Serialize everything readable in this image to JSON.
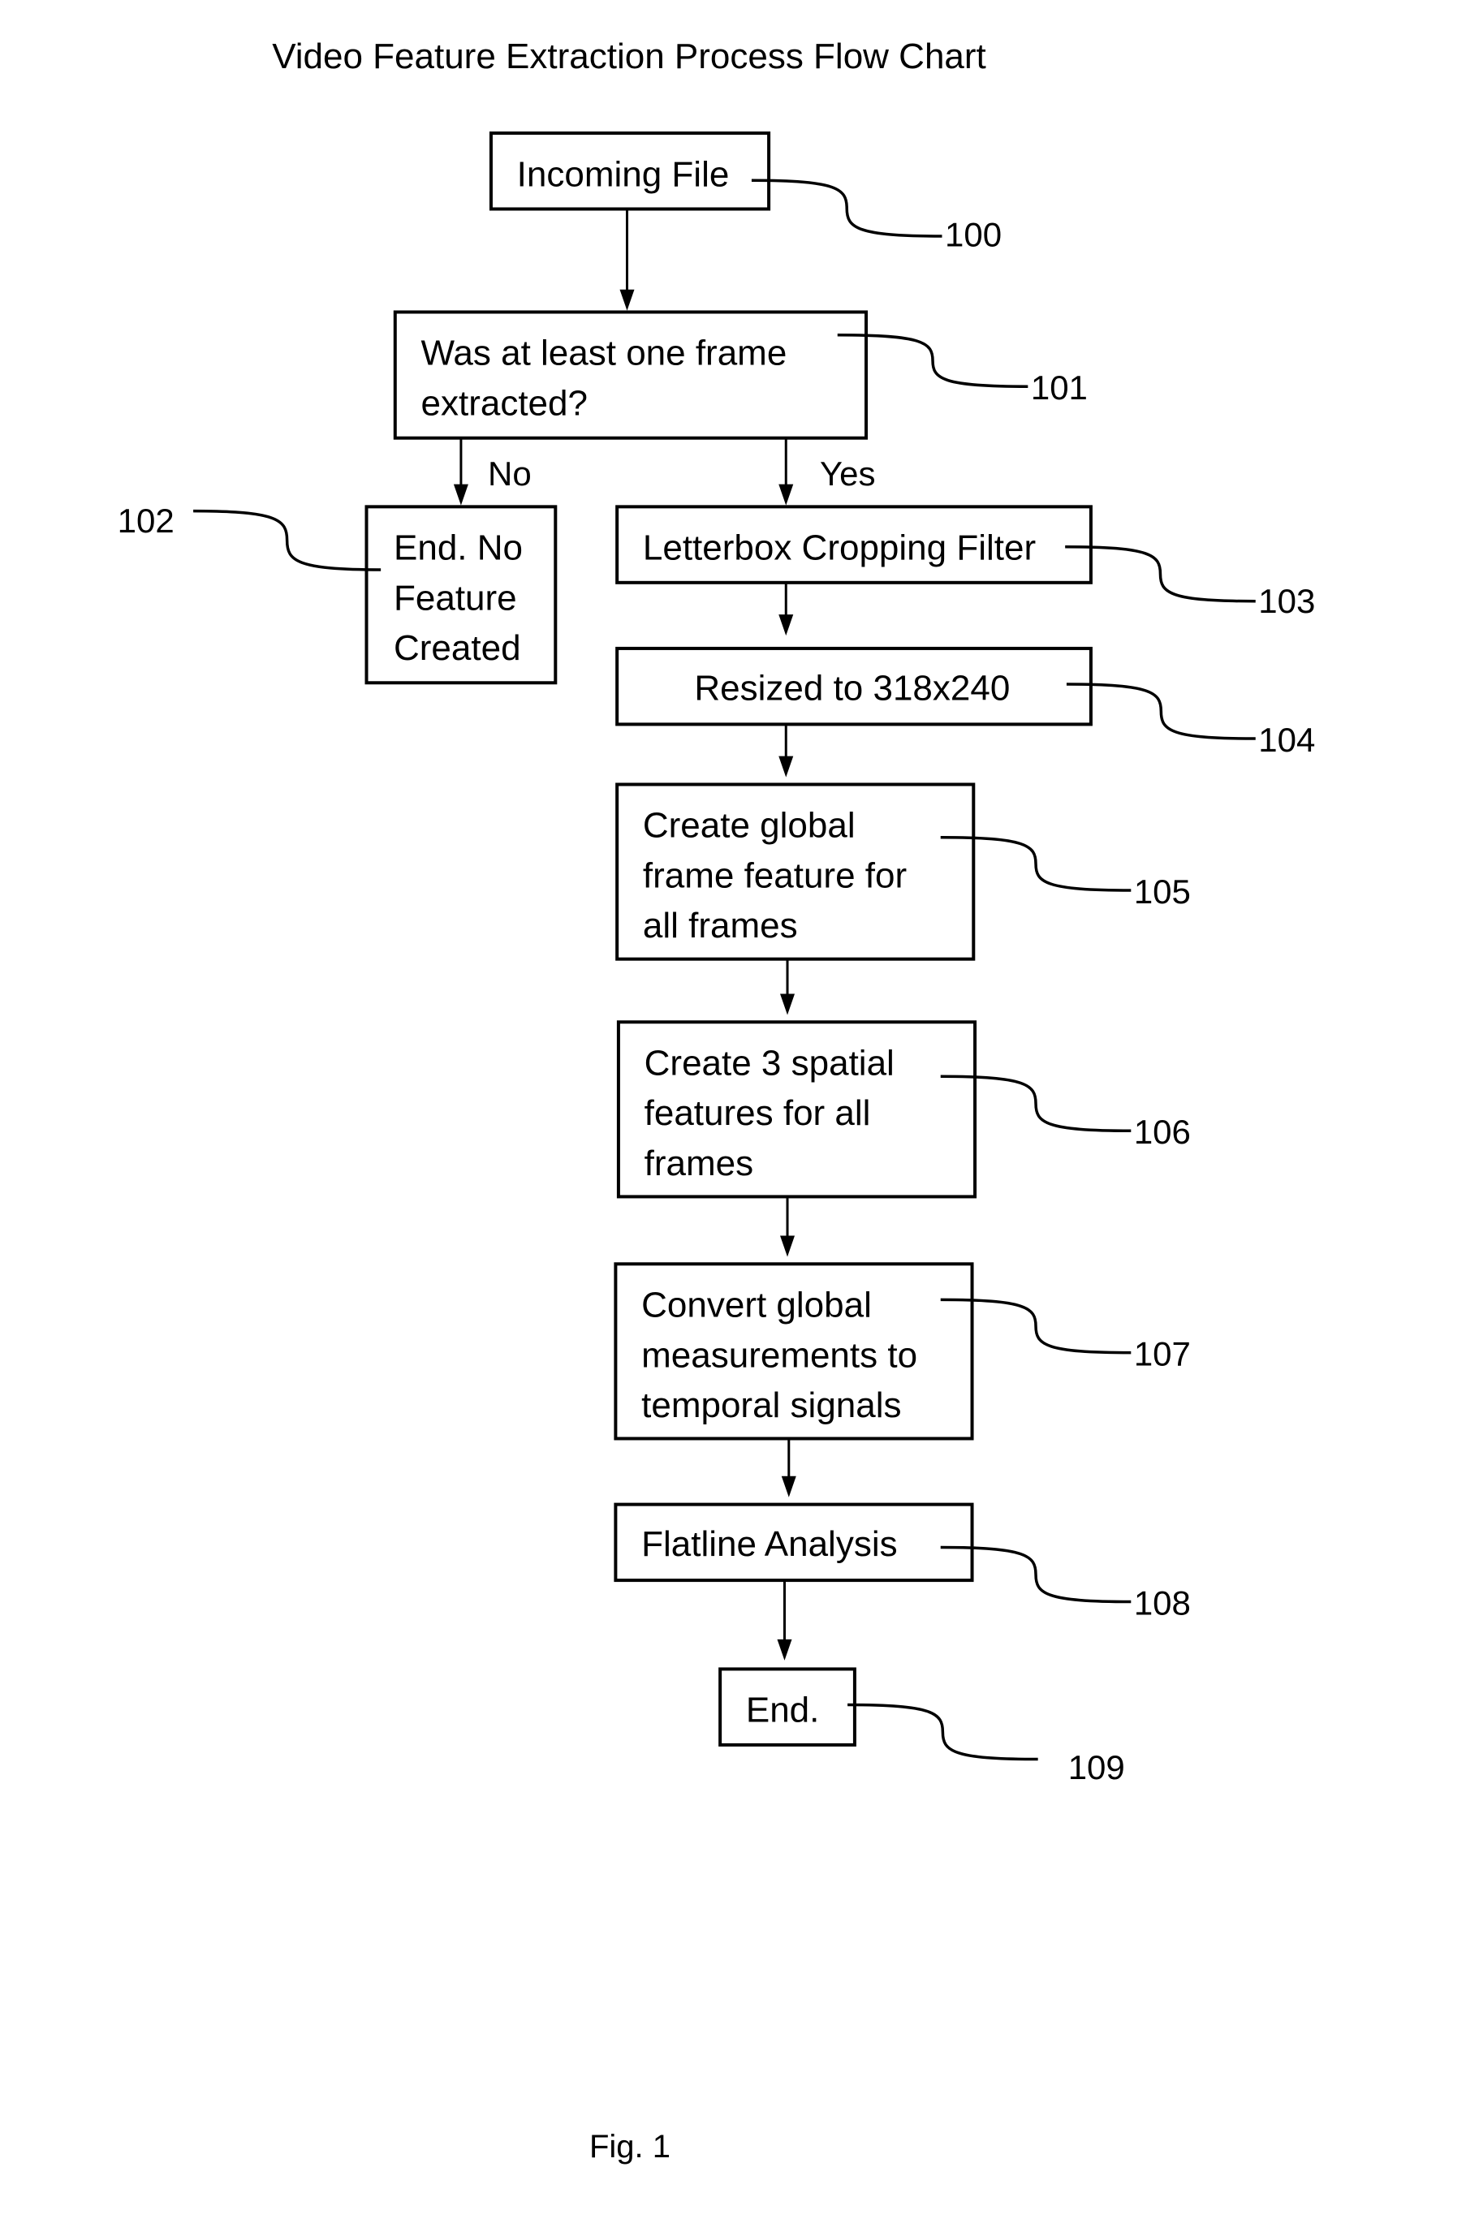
{
  "title": "Video Feature Extraction Process Flow Chart",
  "figure_label": "Fig. 1",
  "nodes": {
    "n100": {
      "ref": "100",
      "lines": [
        "Incoming File"
      ]
    },
    "n101": {
      "ref": "101",
      "lines": [
        "Was at least one frame",
        "extracted?"
      ]
    },
    "n102": {
      "ref": "102",
      "lines": [
        "End. No",
        "Feature",
        "Created"
      ]
    },
    "n103": {
      "ref": "103",
      "lines": [
        "Letterbox Cropping Filter"
      ]
    },
    "n104": {
      "ref": "104",
      "lines": [
        "Resized to 318x240"
      ]
    },
    "n105": {
      "ref": "105",
      "lines": [
        "Create global",
        "frame feature for",
        "all frames"
      ]
    },
    "n106": {
      "ref": "106",
      "lines": [
        "Create 3 spatial",
        "features for all",
        "frames"
      ]
    },
    "n107": {
      "ref": "107",
      "lines": [
        "Convert global",
        "measurements to",
        "temporal signals"
      ]
    },
    "n108": {
      "ref": "108",
      "lines": [
        "Flatline Analysis"
      ]
    },
    "n109": {
      "ref": "109",
      "lines": [
        "End."
      ]
    }
  },
  "branches": {
    "no": "No",
    "yes": "Yes"
  },
  "edges": [
    {
      "from": "n100",
      "to": "n101"
    },
    {
      "from": "n101",
      "to": "n102",
      "label": "No"
    },
    {
      "from": "n101",
      "to": "n103",
      "label": "Yes"
    },
    {
      "from": "n103",
      "to": "n104"
    },
    {
      "from": "n104",
      "to": "n105"
    },
    {
      "from": "n105",
      "to": "n106"
    },
    {
      "from": "n106",
      "to": "n107"
    },
    {
      "from": "n107",
      "to": "n108"
    },
    {
      "from": "n108",
      "to": "n109"
    }
  ]
}
